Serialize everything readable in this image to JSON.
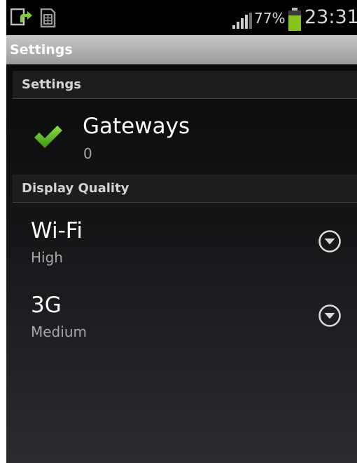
{
  "status_bar": {
    "battery_percent": "77%",
    "battery_level": 0.77,
    "time": "23:31",
    "icons": [
      "screen-share-icon",
      "sim-card-icon",
      "signal-strength-icon",
      "battery-icon"
    ],
    "battery_color": "#86c21a"
  },
  "title_bar": {
    "title": "Settings"
  },
  "sections": [
    {
      "header": "Settings",
      "items": [
        {
          "title": "Gateways",
          "summary": "0",
          "icon": "checkmark-icon",
          "icon_color": "#5cb626"
        }
      ]
    },
    {
      "header": "Display Quality",
      "items": [
        {
          "title": "Wi-Fi",
          "summary": "High",
          "control": "dropdown-arrow-icon"
        },
        {
          "title": "3G",
          "summary": "Medium",
          "control": "dropdown-arrow-icon"
        }
      ]
    }
  ]
}
